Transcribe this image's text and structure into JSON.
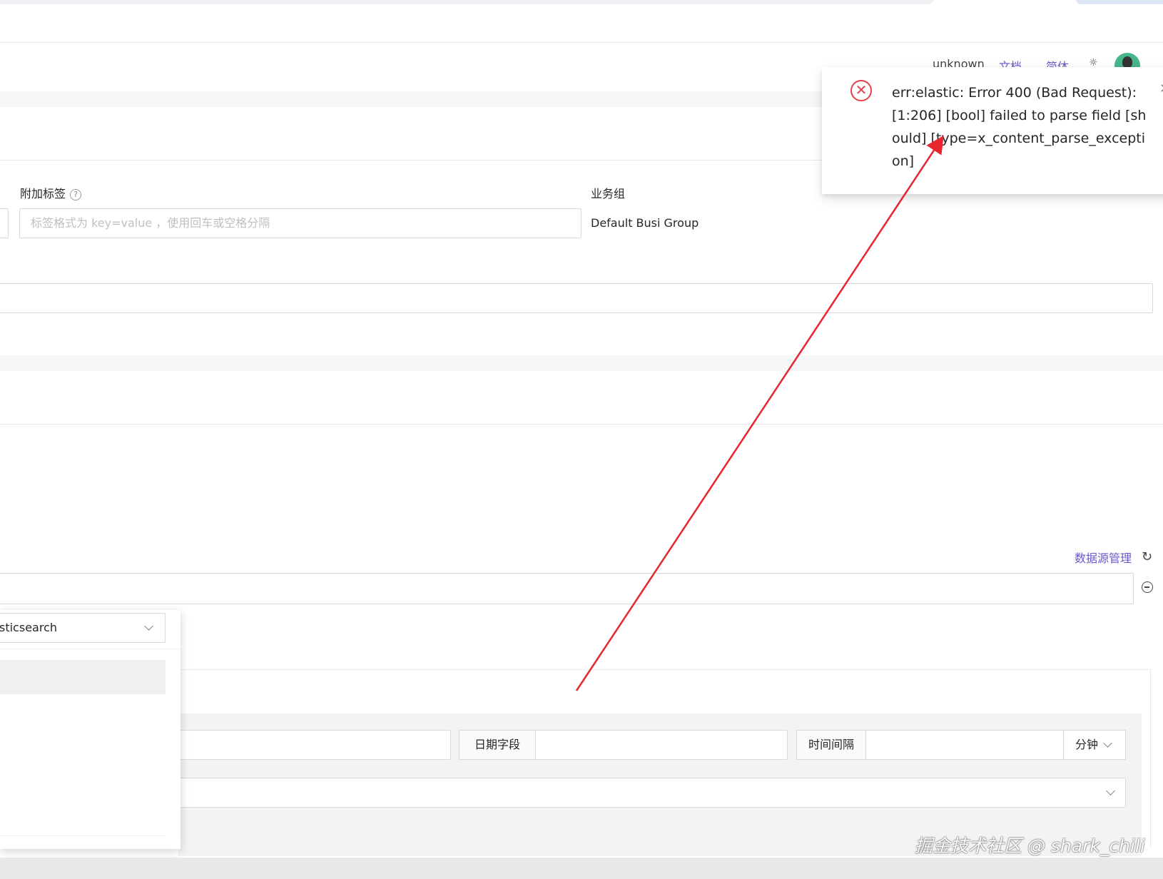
{
  "header": {
    "user": "unknown",
    "docs_link": "文档",
    "lang_link": "简体",
    "theme_icon": "sun-icon"
  },
  "form": {
    "extra_tags_label": "附加标签",
    "extra_tags_placeholder": "标签格式为 key=value ，使用回车或空格分隔",
    "busi_group_label": "业务组",
    "busi_group_value": "Default Busi Group"
  },
  "datasource": {
    "manage_link": "数据源管理",
    "refresh_icon": "refresh-icon",
    "remove_icon": "minus-circle-icon",
    "type_select_value": "sticsearch"
  },
  "query": {
    "date_field_label": "日期字段",
    "interval_label": "时间间隔",
    "interval_unit": "分钟"
  },
  "toast": {
    "type": "error",
    "message": "err:elastic: Error 400 (Bad Request): [1:206] [bool] failed to parse field [should] [type=x_content_parse_exception]",
    "color": "#e8404b"
  },
  "annotation": {
    "arrow_color": "#e8262e"
  },
  "watermark": "掘金技术社区 @ shark_chili"
}
